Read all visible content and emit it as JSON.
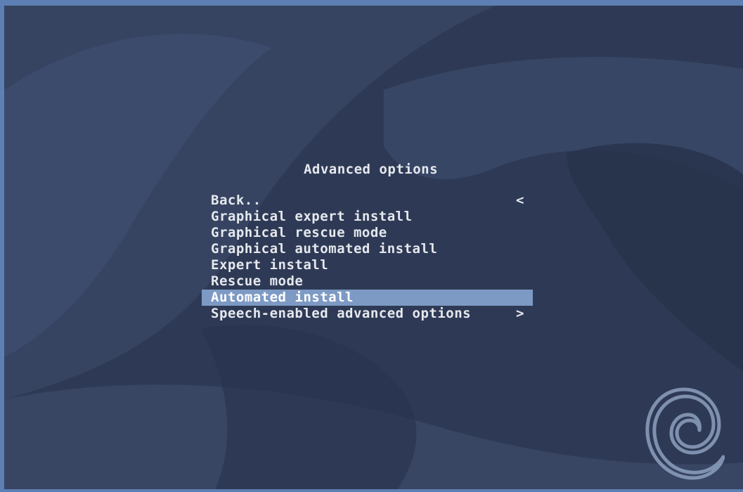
{
  "menu": {
    "title": "Advanced options",
    "items": [
      {
        "label": "Back..",
        "arrow": "<"
      },
      {
        "label": "Graphical expert install",
        "arrow": ""
      },
      {
        "label": "Graphical rescue mode",
        "arrow": ""
      },
      {
        "label": "Graphical automated install",
        "arrow": ""
      },
      {
        "label": "Expert install",
        "arrow": ""
      },
      {
        "label": "Rescue mode",
        "arrow": ""
      },
      {
        "label": "Automated install",
        "arrow": ""
      },
      {
        "label": "Speech-enabled advanced options",
        "arrow": ">"
      }
    ],
    "selected_index": 6
  },
  "colors": {
    "frame": "#5d7fb3",
    "background": "#2e3a55",
    "highlight": "#7d9ac4",
    "text": "#e6e8ee"
  },
  "icons": {
    "logo": "debian-swirl-logo-icon"
  }
}
